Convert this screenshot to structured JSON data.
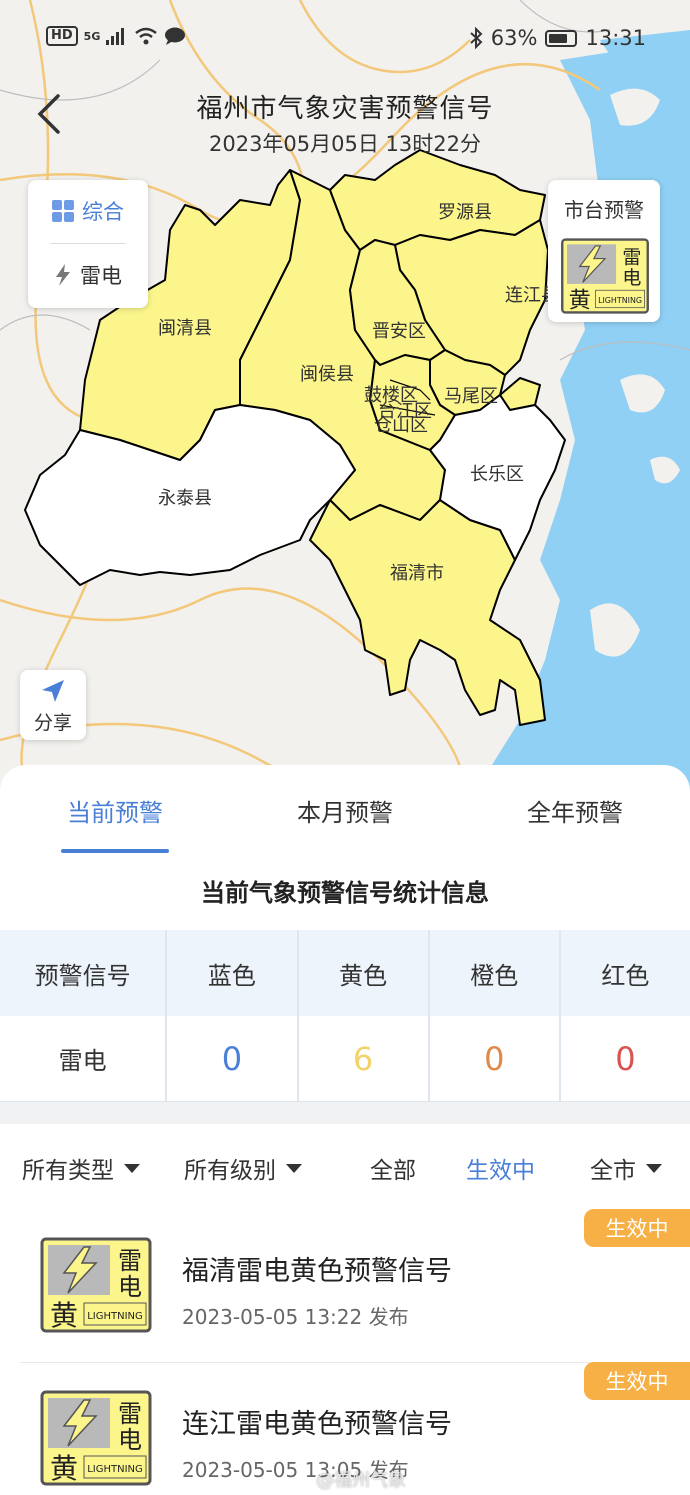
{
  "status_bar": {
    "network": "HD",
    "signal": "5G",
    "battery_percent": "63%",
    "time": "13:31"
  },
  "header": {
    "title": "福州市气象灾害预警信号",
    "subtitle": "2023年05月05日 13时22分"
  },
  "layer_panel": {
    "items": [
      {
        "label": "综合",
        "icon": "grid-icon",
        "active": true
      },
      {
        "label": "雷电",
        "icon": "lightning-icon",
        "active": false
      }
    ]
  },
  "city_card": {
    "label": "市台预警"
  },
  "share": {
    "label": "分享"
  },
  "map_labels": {
    "luoyuan": "罗源县",
    "lianjiang": "连江县",
    "minqing": "闽清县",
    "jinan": "晋安区",
    "minhou": "闽侯县",
    "gulou": "鼓楼区",
    "mawei": "马尾区",
    "taijiang": "台江区",
    "cangshan": "仓山区",
    "changle": "长乐区",
    "yongtai": "永泰县",
    "fuqing": "福清市"
  },
  "tabs": [
    {
      "label": "当前预警",
      "active": true
    },
    {
      "label": "本月预警",
      "active": false
    },
    {
      "label": "全年预警",
      "active": false
    }
  ],
  "stats": {
    "title": "当前气象预警信号统计信息",
    "headers": [
      "预警信号",
      "蓝色",
      "黄色",
      "橙色",
      "红色"
    ],
    "row": {
      "type": "雷电",
      "blue": "0",
      "yellow": "6",
      "orange": "0",
      "red": "0"
    },
    "colors": {
      "blue": "#4a7fd8",
      "yellow": "#f2d36b",
      "orange": "#e08a4a",
      "red": "#d9534f"
    }
  },
  "filters": {
    "type": "所有类型",
    "level": "所有级别",
    "all": "全部",
    "active": "生效中",
    "region": "全市"
  },
  "signal_icon": {
    "top_char1": "雷",
    "top_char2": "电",
    "bottom_char": "黄",
    "text": "LIGHTNING"
  },
  "warnings": [
    {
      "name": "福清雷电黄色预警信号",
      "time": "2023-05-05 13:22 发布",
      "status": "生效中"
    },
    {
      "name": "连江雷电黄色预警信号",
      "time": "2023-05-05 13:05 发布",
      "status": "生效中"
    }
  ],
  "watermark": "@福州气象",
  "theme": {
    "accent": "#4a7fd8",
    "warning_yellow": "#fbf58c",
    "badge": "#f7b045",
    "sea": "#8fd0f4"
  }
}
